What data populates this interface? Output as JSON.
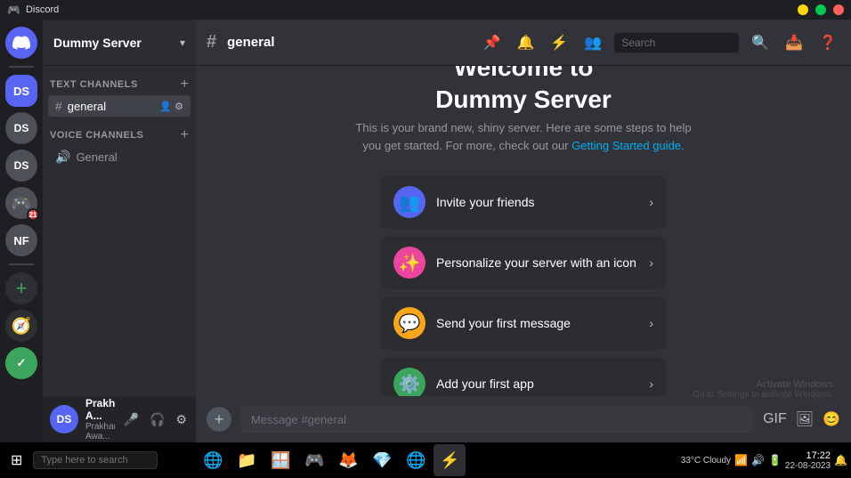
{
  "titlebar": {
    "title": "Discord",
    "icon": "🎮"
  },
  "server_list": {
    "servers": [
      {
        "id": "discord-home",
        "label": "🏠",
        "color": "#5865f2",
        "active": false
      },
      {
        "id": "dummy-server",
        "label": "DS",
        "color": "#5865f2",
        "active": true
      },
      {
        "id": "server-ds2",
        "label": "DS",
        "color": "#4e5058",
        "active": false
      },
      {
        "id": "server-ds3",
        "label": "DS",
        "color": "#4e5058",
        "active": false
      },
      {
        "id": "server-notif",
        "label": "🎮",
        "color": "#4e5058",
        "active": false,
        "badge": "21"
      },
      {
        "id": "server-nf",
        "label": "NF",
        "color": "#4e5058",
        "active": false
      }
    ],
    "add_label": "+",
    "explore_label": "🧭"
  },
  "sidebar": {
    "server_name": "Dummy Server",
    "text_channels_label": "TEXT CHANNELS",
    "voice_channels_label": "VOICE CHANNELS",
    "channels": [
      {
        "id": "general",
        "name": "general",
        "type": "text",
        "active": true
      },
      {
        "id": "general-voice",
        "name": "General",
        "type": "voice",
        "active": false
      }
    ]
  },
  "topbar": {
    "channel_name": "general",
    "icons": [
      "📌",
      "🔔",
      "⚡",
      "👤"
    ],
    "search_placeholder": "Search"
  },
  "welcome": {
    "title_line1": "Welcome to",
    "title_line2": "Dummy Server",
    "subtitle": "This is your brand new, shiny server. Here are some steps to help you get started. For more, check out our",
    "guide_link": "Getting Started guide.",
    "actions": [
      {
        "id": "invite-friends",
        "label": "Invite your friends",
        "icon": "👥",
        "icon_bg": "#5865f2"
      },
      {
        "id": "personalize-server",
        "label": "Personalize your server with an icon",
        "icon": "✨",
        "icon_bg": "#eb459e"
      },
      {
        "id": "send-message",
        "label": "Send your first message",
        "icon": "💬",
        "icon_bg": "#faa61a"
      },
      {
        "id": "add-app",
        "label": "Add your first app",
        "icon": "⚙️",
        "icon_bg": "#3ba55d"
      }
    ]
  },
  "message_bar": {
    "placeholder": "Message #general"
  },
  "user_panel": {
    "name": "Prakhar A...",
    "status": "Prakhar Awa...",
    "initials": "DS"
  },
  "activate_windows": {
    "line1": "Activate Windows",
    "line2": "Go to Settings to activate Windows."
  },
  "taskbar": {
    "search_placeholder": "Type here to search",
    "apps": [
      "🌐",
      "📁",
      "🪟",
      "📦",
      "🦊",
      "💎",
      "🌐",
      "⚡"
    ],
    "time": "17:22",
    "date": "22-08-2023",
    "weather": "33°C Cloudy"
  }
}
